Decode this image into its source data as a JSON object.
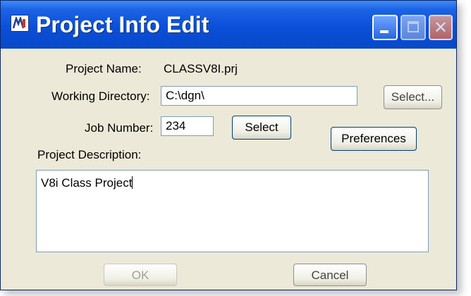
{
  "window": {
    "title": "Project Info Edit",
    "icons": {
      "app": "microstation-icon",
      "minimize": "minimize-icon",
      "maximize": "maximize-icon",
      "close": "close-icon"
    },
    "colors": {
      "titlebar": "#0a4fd8",
      "background": "#ece9d8"
    }
  },
  "form": {
    "project_name_label": "Project Name:",
    "project_name_value": "CLASSV8I.prj",
    "working_dir_label": "Working Directory:",
    "working_dir_value": "C:\\dgn\\",
    "working_dir_select": "Select...",
    "job_number_label": "Job Number:",
    "job_number_value": "234",
    "job_number_select": "Select",
    "preferences_label": "Preferences",
    "description_label": "Project Description:",
    "description_value": "V8i Class Project"
  },
  "footer": {
    "ok_label": "OK",
    "cancel_label": "Cancel"
  }
}
